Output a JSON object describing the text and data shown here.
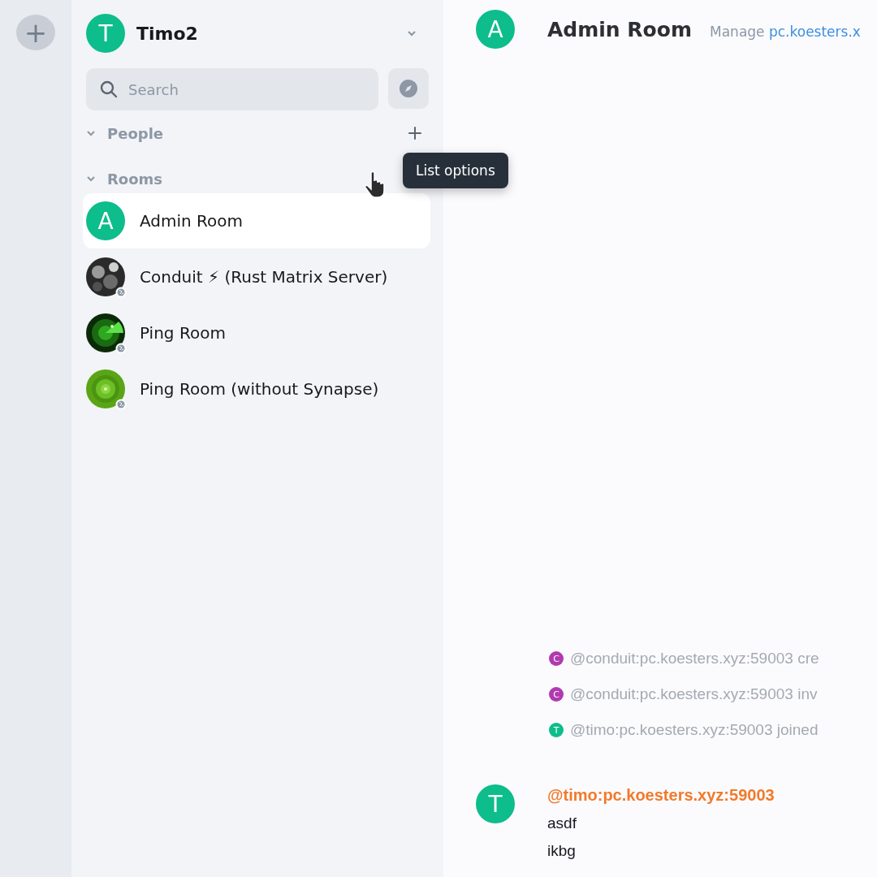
{
  "space_bar": {
    "add_label": "+"
  },
  "account": {
    "initial": "T",
    "name": "Timo2"
  },
  "search": {
    "placeholder": "Search"
  },
  "sections": [
    {
      "title": "People",
      "expanded": true,
      "kind": "add"
    },
    {
      "title": "Rooms",
      "expanded": true,
      "kind": "options"
    }
  ],
  "tooltip": {
    "text": "List options"
  },
  "rooms": [
    {
      "name": "Admin Room",
      "selected": true,
      "avatar": {
        "kind": "letter",
        "letter": "A"
      },
      "public": false
    },
    {
      "name": "Conduit ⚡ (Rust Matrix Server)",
      "selected": false,
      "public": true
    },
    {
      "name": "Ping Room",
      "selected": false,
      "public": true
    },
    {
      "name": "Ping Room (without Synapse)",
      "selected": false,
      "public": true
    }
  ],
  "room_header": {
    "initial": "A",
    "title": "Admin Room",
    "topic_prefix": "Manage",
    "topic_link": "pc.koesters.x"
  },
  "events": [
    {
      "initial": "C",
      "color": "#b03ab0",
      "text": "@conduit:pc.koesters.xyz:59003 cre"
    },
    {
      "initial": "C",
      "color": "#b03ab0",
      "text": "@conduit:pc.koesters.xyz:59003 inv"
    },
    {
      "initial": "T",
      "color": "#0dbd8b",
      "text": "@timo:pc.koesters.xyz:59003 joined"
    }
  ],
  "message": {
    "initial": "T",
    "sender": "@timo:pc.koesters.xyz:59003",
    "lines": [
      "asdf",
      "ikbg"
    ]
  }
}
